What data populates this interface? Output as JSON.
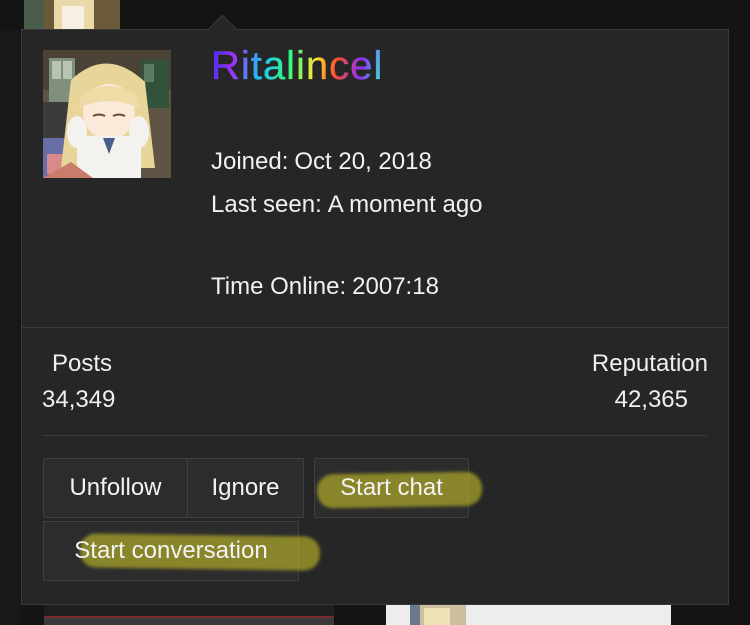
{
  "profile": {
    "username": "Ritalincel",
    "avatar_alt": "avatar",
    "joined_label": "Joined:",
    "joined_value": "Oct 20, 2018",
    "last_seen_label": "Last seen:",
    "last_seen_value": "A moment ago",
    "time_online_label": "Time Online:",
    "time_online_value": "2007:18"
  },
  "stats": {
    "posts_label": "Posts",
    "posts_value": "34,349",
    "reputation_label": "Reputation",
    "reputation_value": "42,365"
  },
  "actions": {
    "unfollow": "Unfollow",
    "ignore": "Ignore",
    "start_chat": "Start chat",
    "start_conversation": "Start conversation"
  },
  "colors": {
    "card_background": "#262626",
    "highlight": "#d6ce28",
    "text": "#f1f1f1"
  }
}
